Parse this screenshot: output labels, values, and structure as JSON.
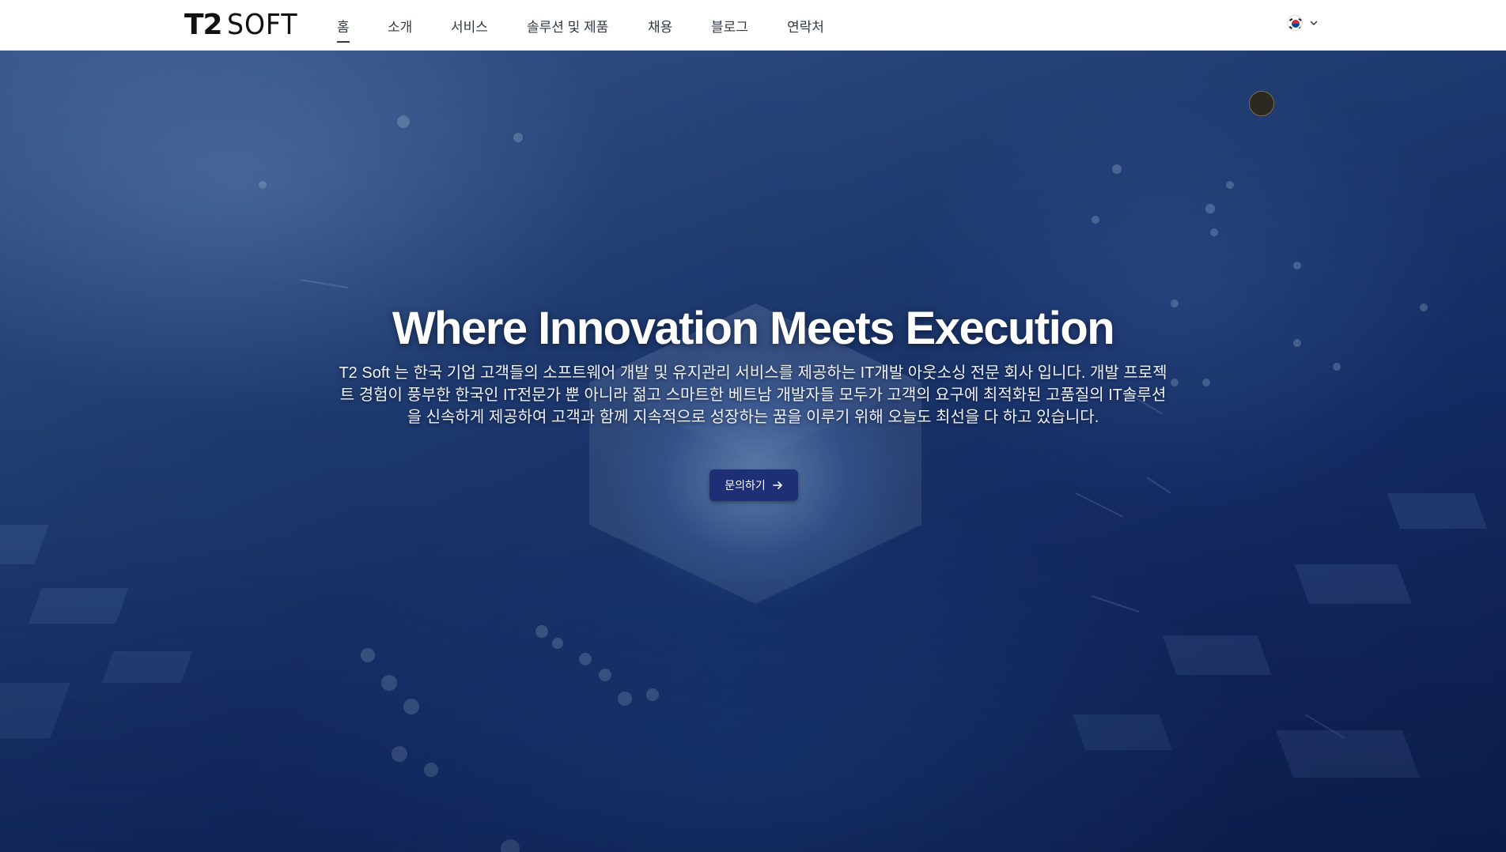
{
  "header": {
    "logo_main": "T2",
    "logo_sub": "SOFT",
    "nav": [
      {
        "label": "홈",
        "active": true
      },
      {
        "label": "소개"
      },
      {
        "label": "서비스"
      },
      {
        "label": "솔루션 및 제품"
      },
      {
        "label": "채용"
      },
      {
        "label": "블로그"
      },
      {
        "label": "연락처"
      }
    ],
    "language_icon": "korea-flag-icon",
    "language_chevron": "chevron-down-icon"
  },
  "hero": {
    "title": "Where Innovation Meets Execution",
    "description": "T2 Soft 는 한국 기업 고객들의 소프트웨어 개발 및 유지관리 서비스를 제공하는 IT개발 아웃소싱 전문 회사 입니다. 개발 프로젝트 경험이 풍부한 한국인 IT전문가 뿐 아니라 젊고 스마트한 베트남 개발자들 모두가 고객의 요구에 최적화된 고품질의 IT솔루션을 신속하게 제공하여 고객과 함께 지속적으로 성장하는 꿈을 이루기 위해 오늘도 최선을 다 하고 있습니다.",
    "cta_label": "문의하기",
    "cta_icon": "arrow-right-icon"
  },
  "colors": {
    "cta_bg": "#1e2f75",
    "hero_dark": "#0e1f4e",
    "hero_light": "#3f5f94"
  }
}
